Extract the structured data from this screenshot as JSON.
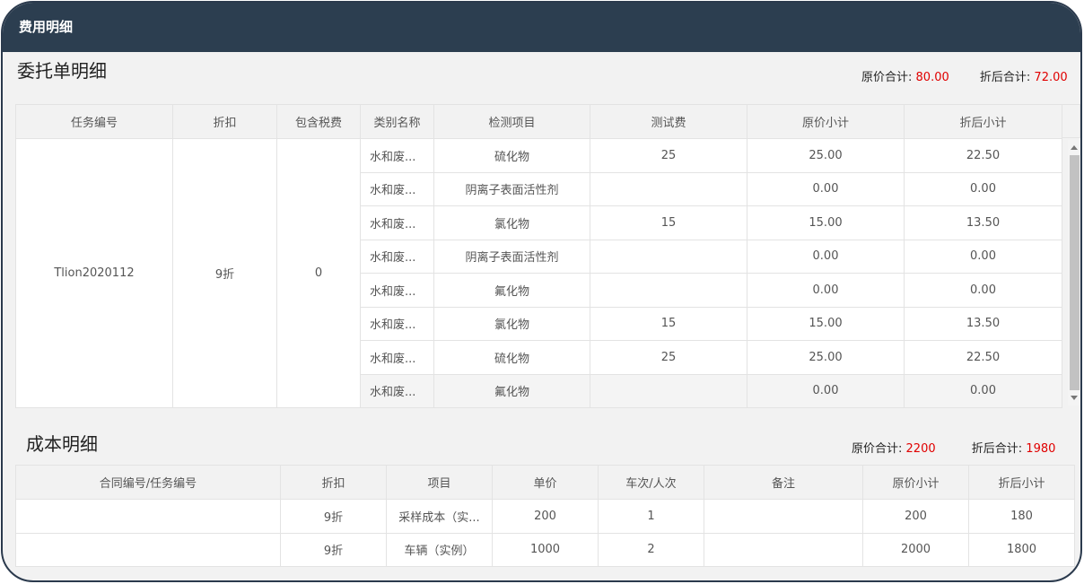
{
  "window": {
    "title": "费用明细"
  },
  "entrust": {
    "title": "委托单明细",
    "original_total_label": "原价合计:",
    "original_total_value": "80.00",
    "discount_total_label": "折后合计:",
    "discount_total_value": "72.00",
    "columns": [
      "任务编号",
      "折扣",
      "包含税费",
      "类别名称",
      "检测项目",
      "测试费",
      "原价小计",
      "折后小计"
    ],
    "task_no": "Tlion2020112",
    "discount": "9折",
    "tax_included": "0",
    "rows": [
      {
        "category": "水和废...",
        "item": "硫化物",
        "fee": "25",
        "orig": "25.00",
        "disc": "22.50"
      },
      {
        "category": "水和废...",
        "item": "阴离子表面活性剂",
        "fee": "",
        "orig": "0.00",
        "disc": "0.00"
      },
      {
        "category": "水和废...",
        "item": "氯化物",
        "fee": "15",
        "orig": "15.00",
        "disc": "13.50"
      },
      {
        "category": "水和废...",
        "item": "阴离子表面活性剂",
        "fee": "",
        "orig": "0.00",
        "disc": "0.00"
      },
      {
        "category": "水和废...",
        "item": "氟化物",
        "fee": "",
        "orig": "0.00",
        "disc": "0.00"
      },
      {
        "category": "水和废...",
        "item": "氯化物",
        "fee": "15",
        "orig": "15.00",
        "disc": "13.50"
      },
      {
        "category": "水和废...",
        "item": "硫化物",
        "fee": "25",
        "orig": "25.00",
        "disc": "22.50"
      },
      {
        "category": "水和废...",
        "item": "氟化物",
        "fee": "",
        "orig": "0.00",
        "disc": "0.00"
      }
    ]
  },
  "cost": {
    "title": "成本明细",
    "original_total_label": "原价合计:",
    "original_total_value": "2200",
    "discount_total_label": "折后合计:",
    "discount_total_value": "1980",
    "columns": [
      "合同编号/任务编号",
      "折扣",
      "项目",
      "单价",
      "车次/人次",
      "备注",
      "原价小计",
      "折后小计"
    ],
    "rows": [
      {
        "contract": "",
        "discount": "9折",
        "item": "采样成本（实...",
        "price": "200",
        "count": "1",
        "note": "",
        "orig": "200",
        "disc": "180"
      },
      {
        "contract": "",
        "discount": "9折",
        "item": "车辆（实例）",
        "price": "1000",
        "count": "2",
        "note": "",
        "orig": "2000",
        "disc": "1800"
      }
    ]
  },
  "colors": {
    "titlebar": "#2c3e50",
    "total_value": "#e00000"
  }
}
